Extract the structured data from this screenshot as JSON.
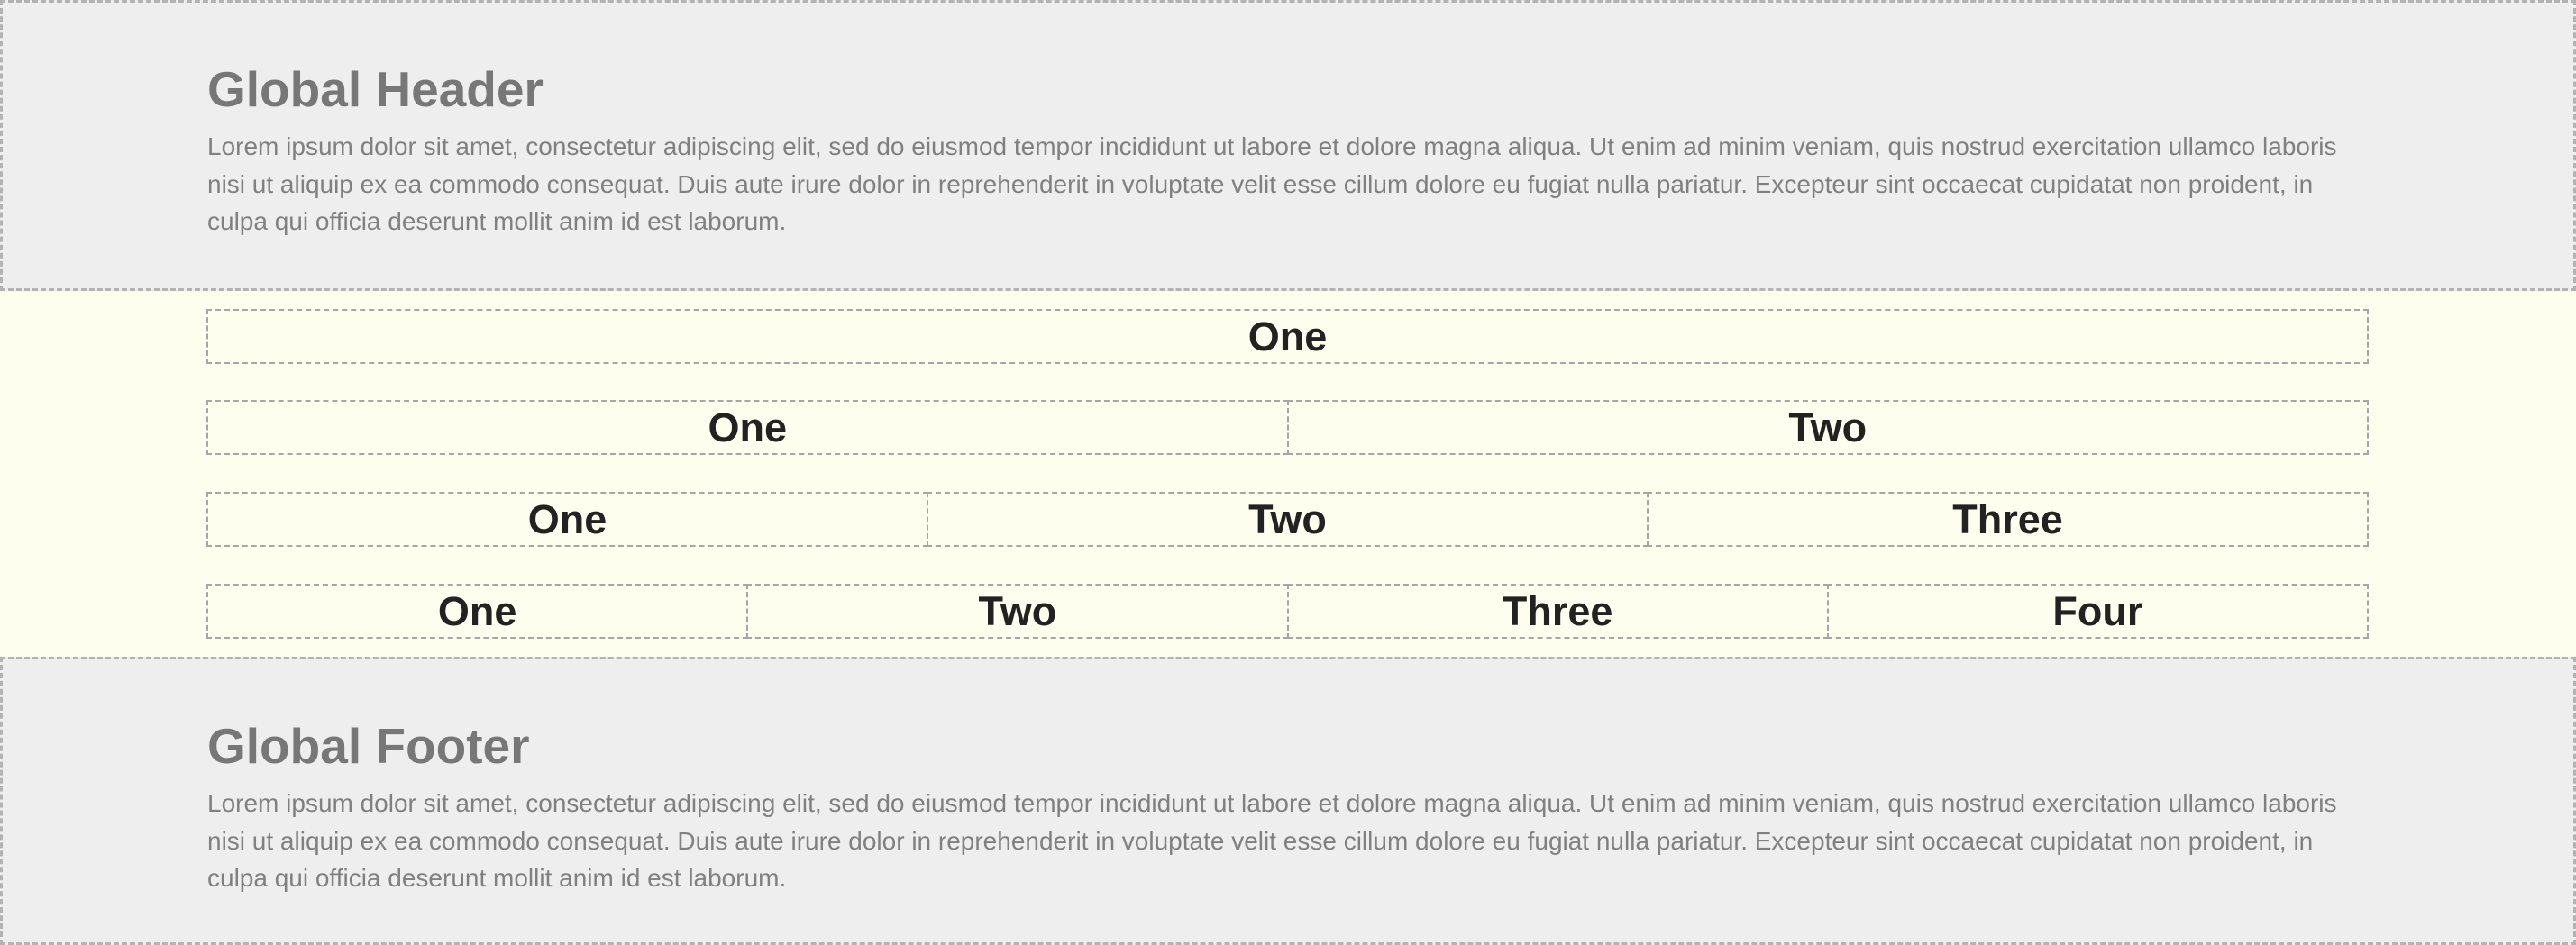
{
  "header": {
    "title": "Global Header",
    "text": "Lorem ipsum dolor sit amet, consectetur adipiscing elit, sed do eiusmod tempor incididunt ut labore et dolore magna aliqua. Ut enim ad minim veniam, quis nostrud exercitation ullamco laboris nisi ut aliquip ex ea commodo consequat. Duis aute irure dolor in reprehenderit in voluptate velit esse cillum dolore eu fugiat nulla pariatur. Excepteur sint occaecat cupidatat non proident, in culpa qui officia deserunt mollit anim id est laborum."
  },
  "rows": [
    [
      "One"
    ],
    [
      "One",
      "Two"
    ],
    [
      "One",
      "Two",
      "Three"
    ],
    [
      "One",
      "Two",
      "Three",
      "Four"
    ]
  ],
  "footer": {
    "title": "Global Footer",
    "text": "Lorem ipsum dolor sit amet, consectetur adipiscing elit, sed do eiusmod tempor incididunt ut labore et dolore magna aliqua. Ut enim ad minim veniam, quis nostrud exercitation ullamco laboris nisi ut aliquip ex ea commodo consequat. Duis aute irure dolor in reprehenderit in voluptate velit esse cillum dolore eu fugiat nulla pariatur. Excepteur sint occaecat cupidatat non proident, in culpa qui officia deserunt mollit anim id est laborum."
  },
  "colors": {
    "band_background": "#eeeeee",
    "band_border": "#b3b3b3",
    "content_background": "#fefeef",
    "cell_border": "#a6a6a6",
    "heading_text": "#777777",
    "body_text": "#808080",
    "cell_text": "#222222"
  }
}
